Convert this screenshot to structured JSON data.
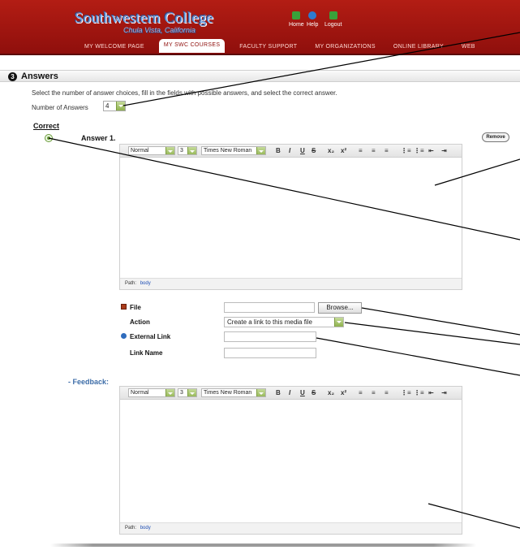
{
  "header": {
    "logo_main": "Southwestern College",
    "logo_sub": "Chula Vista, California",
    "util_links": [
      "Home",
      "Help",
      "Logout"
    ],
    "util_colors": [
      "#3aa13a",
      "#2d7bd0",
      "#3aa13a"
    ],
    "nav": [
      "MY WELCOME PAGE",
      "MY SWC COURSES",
      "FACULTY SUPPORT",
      "MY ORGANIZATIONS",
      "ONLINE LIBRARY",
      "WEB"
    ],
    "active_nav": "MY SWC COURSES"
  },
  "section": {
    "step": "3",
    "title": "Answers",
    "instructions": "Select the number of answer choices, fill in the fields with possible answers, and select the correct answer.",
    "num_answers_label": "Number of Answers",
    "num_answers_value": "4"
  },
  "answer": {
    "correct_header": "Correct",
    "label": "Answer 1.",
    "remove_label": "Remove",
    "selected": true
  },
  "editor": {
    "format": "Normal",
    "size": "3",
    "font": "Times New Roman",
    "buttons": [
      "B",
      "I",
      "U",
      "S",
      "x₂",
      "x²",
      "≡",
      "≡",
      "≡",
      "⋮≡",
      "⋮≡",
      "⇤",
      "⇥"
    ],
    "path_label": "Path:",
    "path_value": "body"
  },
  "media": {
    "file_label": "File",
    "browse_label": "Browse...",
    "action_label": "Action",
    "action_value": "Create a link to this media file",
    "external_link_label": "External Link",
    "link_name_label": "Link Name"
  },
  "feedback": {
    "label": "- Feedback:"
  },
  "colors": {
    "header_red": "#a0140f",
    "accent_green": "#8fb14d",
    "feedback_blue": "#3d6da8"
  }
}
